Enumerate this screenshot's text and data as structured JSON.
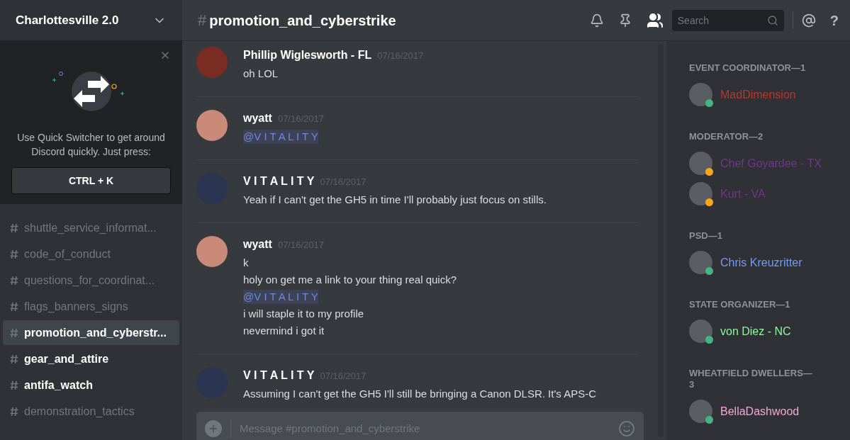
{
  "server": {
    "name": "Charlottesville 2.0"
  },
  "quick_switcher": {
    "text": "Use Quick Switcher to get around Discord quickly. Just press:",
    "shortcut": "CTRL + K"
  },
  "channels": [
    {
      "name": "shuttle_service_informat...",
      "selected": false,
      "unread": false
    },
    {
      "name": "code_of_conduct",
      "selected": false,
      "unread": false
    },
    {
      "name": "questions_for_coordinat...",
      "selected": false,
      "unread": false
    },
    {
      "name": "flags_banners_signs",
      "selected": false,
      "unread": false
    },
    {
      "name": "promotion_and_cyberstr...",
      "selected": true,
      "unread": false
    },
    {
      "name": "gear_and_attire",
      "selected": false,
      "unread": true
    },
    {
      "name": "antifa_watch",
      "selected": false,
      "unread": true
    },
    {
      "name": "demonstration_tactics",
      "selected": false,
      "unread": false
    }
  ],
  "header": {
    "hash": "#",
    "channel": "promotion_and_cyberstrike",
    "search_placeholder": "Search",
    "help": "?"
  },
  "messages": [
    {
      "author": "Phillip Wiglesworth - FL",
      "time": "07/16/2017",
      "lines": [
        {
          "kind": "text",
          "text": "oh LOL"
        }
      ]
    },
    {
      "author": "wyatt",
      "time": "07/16/2017",
      "lines": [
        {
          "kind": "mention",
          "text": "@V I T A L I T Y"
        }
      ]
    },
    {
      "author": "V I T A L I T Y",
      "time": "07/16/2017",
      "lines": [
        {
          "kind": "text",
          "text": "Yeah if I can't get the GH5 in time I'll probably just focus on stills."
        }
      ]
    },
    {
      "author": "wyatt",
      "time": "07/16/2017",
      "lines": [
        {
          "kind": "text",
          "text": "k"
        },
        {
          "kind": "text",
          "text": "holy on get me a link to your thing real quick?"
        },
        {
          "kind": "mention",
          "text": "@V I T A L I T Y"
        },
        {
          "kind": "text",
          "text": "i will staple it to my profile"
        },
        {
          "kind": "text",
          "text": "nevermind i got it"
        }
      ]
    },
    {
      "author": "V I T A L I T Y",
      "time": "07/16/2017",
      "lines": [
        {
          "kind": "text",
          "text": "Assuming I can't get the GH5 I'll still be bringing a Canon DLSR. It's APS-C"
        }
      ]
    }
  ],
  "composer": {
    "placeholder": "Message #promotion_and_cyberstrike"
  },
  "member_groups": [
    {
      "title": "EVENT COORDINATOR—1",
      "color": "#b7372e",
      "members": [
        {
          "name": "MadDimension",
          "color": "#43b581"
        }
      ]
    },
    {
      "title": "MODERATOR—2",
      "color": "#71368a",
      "members": [
        {
          "name": "Chef Goyardee - TX",
          "color": "#faa61a"
        },
        {
          "name": "Kurt - VA",
          "color": "#faa61a"
        }
      ]
    },
    {
      "title": "PSD—1",
      "color": "#6f9cf5",
      "members": [
        {
          "name": "Chris Kreuzritter",
          "color": "#43b581"
        }
      ]
    },
    {
      "title": "STATE ORGANIZER—1",
      "color": "#8ef59b",
      "members": [
        {
          "name": "von Diez - NC",
          "color": "#43b581"
        }
      ]
    },
    {
      "title": "WHEATFIELD DWELLERS—3",
      "color": "#f4a6d7",
      "members": [
        {
          "name": "BellaDashwood",
          "color": "#43b581"
        }
      ]
    }
  ]
}
